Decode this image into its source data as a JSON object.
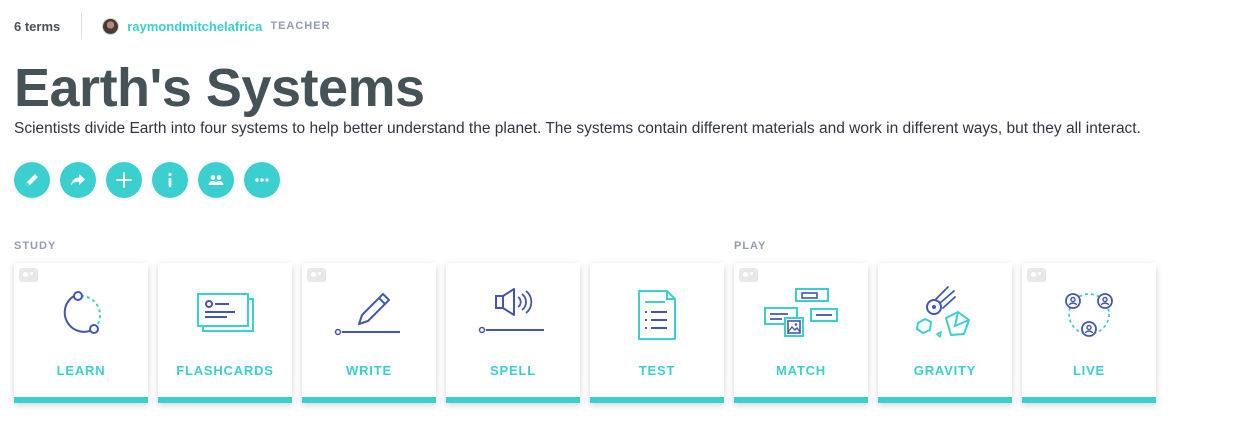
{
  "header": {
    "terms_count": "6 terms",
    "username": "raymondmitchelafrica",
    "role": "TEACHER"
  },
  "set": {
    "title": "Earth's Systems",
    "description": "Scientists divide Earth into four systems to help better understand the planet. The systems contain different materials and work in different ways, but they all interact."
  },
  "actions": [
    {
      "icon": "pencil-icon",
      "name": "edit"
    },
    {
      "icon": "share-arrow-icon",
      "name": "share"
    },
    {
      "icon": "plus-icon",
      "name": "add"
    },
    {
      "icon": "info-icon",
      "name": "info"
    },
    {
      "icon": "people-icon",
      "name": "classes"
    },
    {
      "icon": "more-icon",
      "name": "more"
    }
  ],
  "sections": {
    "study_label": "STUDY",
    "play_label": "PLAY"
  },
  "modes": [
    {
      "label": "LEARN",
      "icon": "learn-icon",
      "badge": true
    },
    {
      "label": "FLASHCARDS",
      "icon": "flashcards-icon",
      "badge": false
    },
    {
      "label": "WRITE",
      "icon": "write-icon",
      "badge": true
    },
    {
      "label": "SPELL",
      "icon": "spell-icon",
      "badge": false
    },
    {
      "label": "TEST",
      "icon": "test-icon",
      "badge": false
    },
    {
      "label": "MATCH",
      "icon": "match-icon",
      "badge": true
    },
    {
      "label": "GRAVITY",
      "icon": "gravity-icon",
      "badge": false
    },
    {
      "label": "LIVE",
      "icon": "live-icon",
      "badge": true
    }
  ],
  "colors": {
    "accent": "#3ccfcf",
    "icon_navy": "#4257b2",
    "title": "#455358",
    "muted": "#939bb4"
  }
}
